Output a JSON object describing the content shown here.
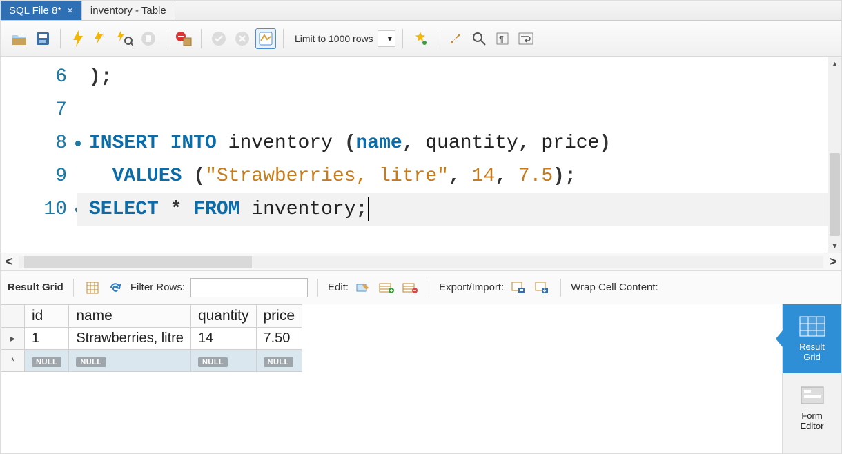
{
  "tabs": [
    {
      "label": "SQL File 8*",
      "active": true,
      "has_close": true
    },
    {
      "label": "inventory - Table",
      "active": false,
      "has_close": false
    }
  ],
  "toolbar": {
    "limit_label": "Limit to 1000 rows"
  },
  "editor": {
    "lines": [
      {
        "num": "6",
        "marker": false,
        "tokens": [
          {
            "t": "punc",
            "v": ");"
          }
        ]
      },
      {
        "num": "7",
        "marker": false,
        "tokens": []
      },
      {
        "num": "8",
        "marker": true,
        "tokens": [
          {
            "t": "kw",
            "v": "INSERT INTO"
          },
          {
            "t": "ident",
            "v": " inventory "
          },
          {
            "t": "punc",
            "v": "("
          },
          {
            "t": "col",
            "v": "name"
          },
          {
            "t": "punc",
            "v": ", "
          },
          {
            "t": "ident",
            "v": "quantity"
          },
          {
            "t": "punc",
            "v": ", "
          },
          {
            "t": "ident",
            "v": "price"
          },
          {
            "t": "punc",
            "v": ")"
          }
        ]
      },
      {
        "num": "9",
        "marker": false,
        "tokens": [
          {
            "t": "ident",
            "v": "  "
          },
          {
            "t": "kw",
            "v": "VALUES"
          },
          {
            "t": "ident",
            "v": " "
          },
          {
            "t": "punc",
            "v": "("
          },
          {
            "t": "str",
            "v": "\"Strawberries, litre\""
          },
          {
            "t": "punc",
            "v": ", "
          },
          {
            "t": "num",
            "v": "14"
          },
          {
            "t": "punc",
            "v": ", "
          },
          {
            "t": "num",
            "v": "7.5"
          },
          {
            "t": "punc",
            "v": ");"
          }
        ]
      },
      {
        "num": "10",
        "marker": true,
        "hl": true,
        "cursor_after": true,
        "tokens": [
          {
            "t": "kw",
            "v": "SELECT"
          },
          {
            "t": "ident",
            "v": " "
          },
          {
            "t": "punc",
            "v": "*"
          },
          {
            "t": "ident",
            "v": " "
          },
          {
            "t": "kw",
            "v": "FROM"
          },
          {
            "t": "ident",
            "v": " inventory"
          },
          {
            "t": "punc",
            "v": ";"
          }
        ]
      }
    ]
  },
  "results": {
    "toolbar": {
      "title": "Result Grid",
      "filter_label": "Filter Rows:",
      "filter_value": "",
      "edit_label": "Edit:",
      "export_label": "Export/Import:",
      "wrap_label": "Wrap Cell Content:"
    },
    "columns": [
      "id",
      "name",
      "quantity",
      "price"
    ],
    "rows": [
      {
        "selector": "▸",
        "cells": [
          "1",
          "Strawberries, litre",
          "14",
          "7.50"
        ],
        "null_row": false
      },
      {
        "selector": "*",
        "cells": [
          "NULL",
          "NULL",
          "NULL",
          "NULL"
        ],
        "null_row": true
      }
    ]
  },
  "sidepanel": {
    "items": [
      {
        "label": "Result Grid",
        "active": true,
        "icon": "grid"
      },
      {
        "label": "Form Editor",
        "active": false,
        "icon": "form"
      }
    ]
  }
}
